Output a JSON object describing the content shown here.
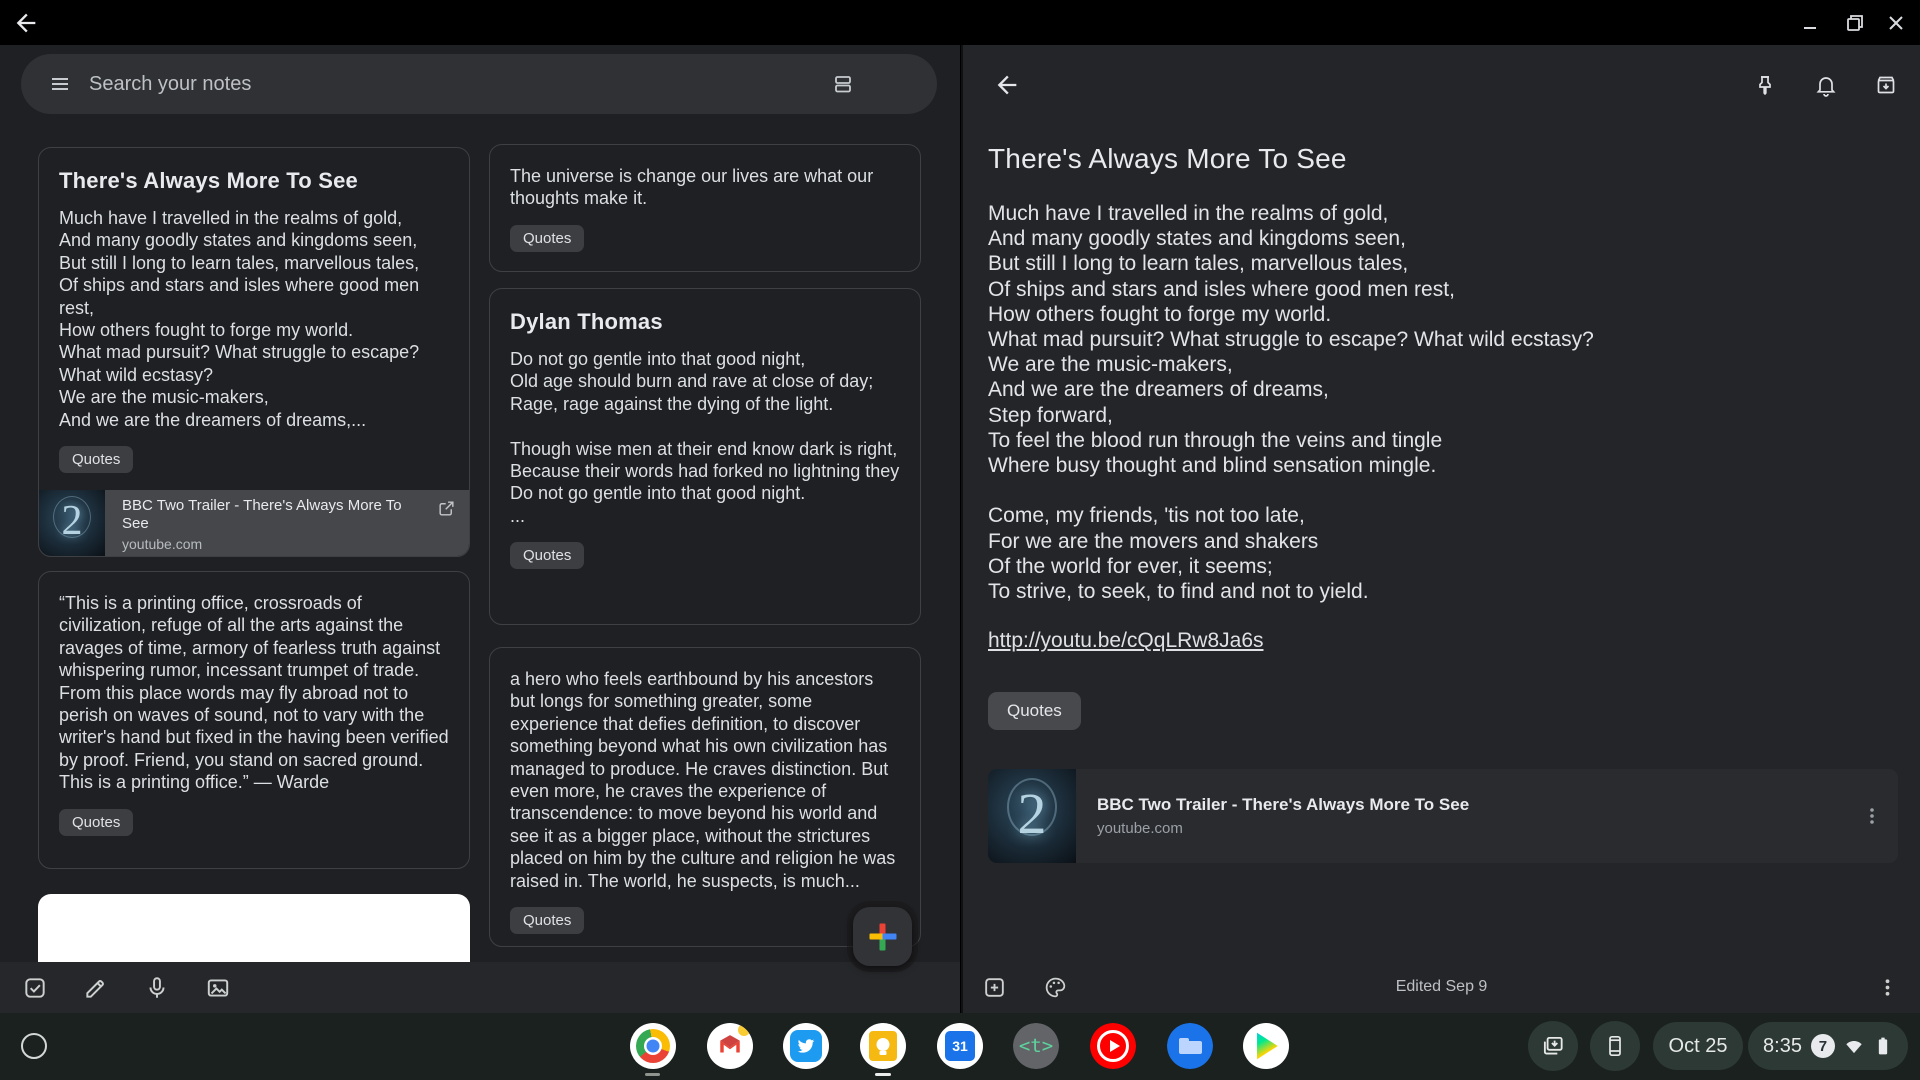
{
  "accent_colors": {
    "panel_left": "#1f2023",
    "panel_right": "#242528",
    "shelf": "#1b211f",
    "chip": "#3c3e42",
    "preview_row": "#46474b"
  },
  "search": {
    "placeholder": "Search your notes"
  },
  "notes": {
    "col1": [
      {
        "title": "There's Always More To See",
        "body": "Much have I travelled in the realms of gold,\nAnd many goodly states and kingdoms seen,\nBut still I long to learn tales, marvellous tales,\nOf ships and stars and isles where good men rest,\nHow others fought to forge my world.\nWhat mad pursuit? What struggle to escape? What wild ecstasy?\nWe are the music-makers,\nAnd we are the dreamers of dreams,...",
        "label": "Quotes",
        "link_preview": {
          "title": "BBC Two Trailer - There's Always More To See",
          "domain": "youtube.com"
        }
      },
      {
        "body": "“This is a printing office, crossroads of civilization, refuge of all the arts against the ravages of time, armory of fearless truth against whispering rumor, incessant trumpet of trade. From this place words may fly abroad not to perish on waves of sound, not to vary with the writer's hand but fixed in the having been verified by proof. Friend, you stand on sacred ground. This is a printing office.” — Warde",
        "label": "Quotes"
      }
    ],
    "col2": [
      {
        "body": "The universe is change our lives are what our thoughts make it.",
        "label": "Quotes"
      },
      {
        "title": "Dylan Thomas",
        "body": "Do not go gentle into that good night,\nOld age should burn and rave at close of day;\nRage, rage against the dying of the light.\n\nThough wise men at their end know dark is right,\nBecause their words had forked no lightning they\nDo not go gentle into that good night.\n...",
        "label": "Quotes"
      },
      {
        "body": "a hero who feels earthbound by his ancestors but longs for something greater, some experience that defies definition, to discover something beyond what his own civilization has managed to produce. He craves distinction. But even more, he craves the experience of transcendence: to move beyond his world and see it as a bigger place, without the strictures placed on him by the culture and religion he was raised in. The world, he suspects, is much...",
        "label": "Quotes"
      }
    ]
  },
  "detail": {
    "title": "There's Always More To See",
    "body": "Much have I travelled in the realms of gold,\nAnd many goodly states and kingdoms seen,\nBut still I long to learn tales, marvellous tales,\nOf ships and stars and isles where good men rest,\nHow others fought to forge my world.\nWhat mad pursuit? What struggle to escape? What wild ecstasy?\nWe are the music-makers,\nAnd we are the dreamers of dreams,\nStep forward,\nTo feel the blood run through the veins and tingle\nWhere busy thought and blind sensation mingle.\n\nCome, my friends, 'tis not too late,\nFor we are the movers and shakers\nOf the world for ever, it seems;\nTo strive, to seek, to find and not to yield.",
    "link": "http://youtu.be/cQqLRw8Ja6s",
    "label": "Quotes",
    "link_card": {
      "title": "BBC Two Trailer - There's Always More To See",
      "domain": "youtube.com"
    },
    "edited": "Edited Sep 9"
  },
  "thumbnail": {
    "glyph": "2"
  },
  "shelf": {
    "date": "Oct 25",
    "time": "8:35",
    "notification_count": "7",
    "calendar_glyph": "31",
    "code_glyph": "<t>"
  }
}
